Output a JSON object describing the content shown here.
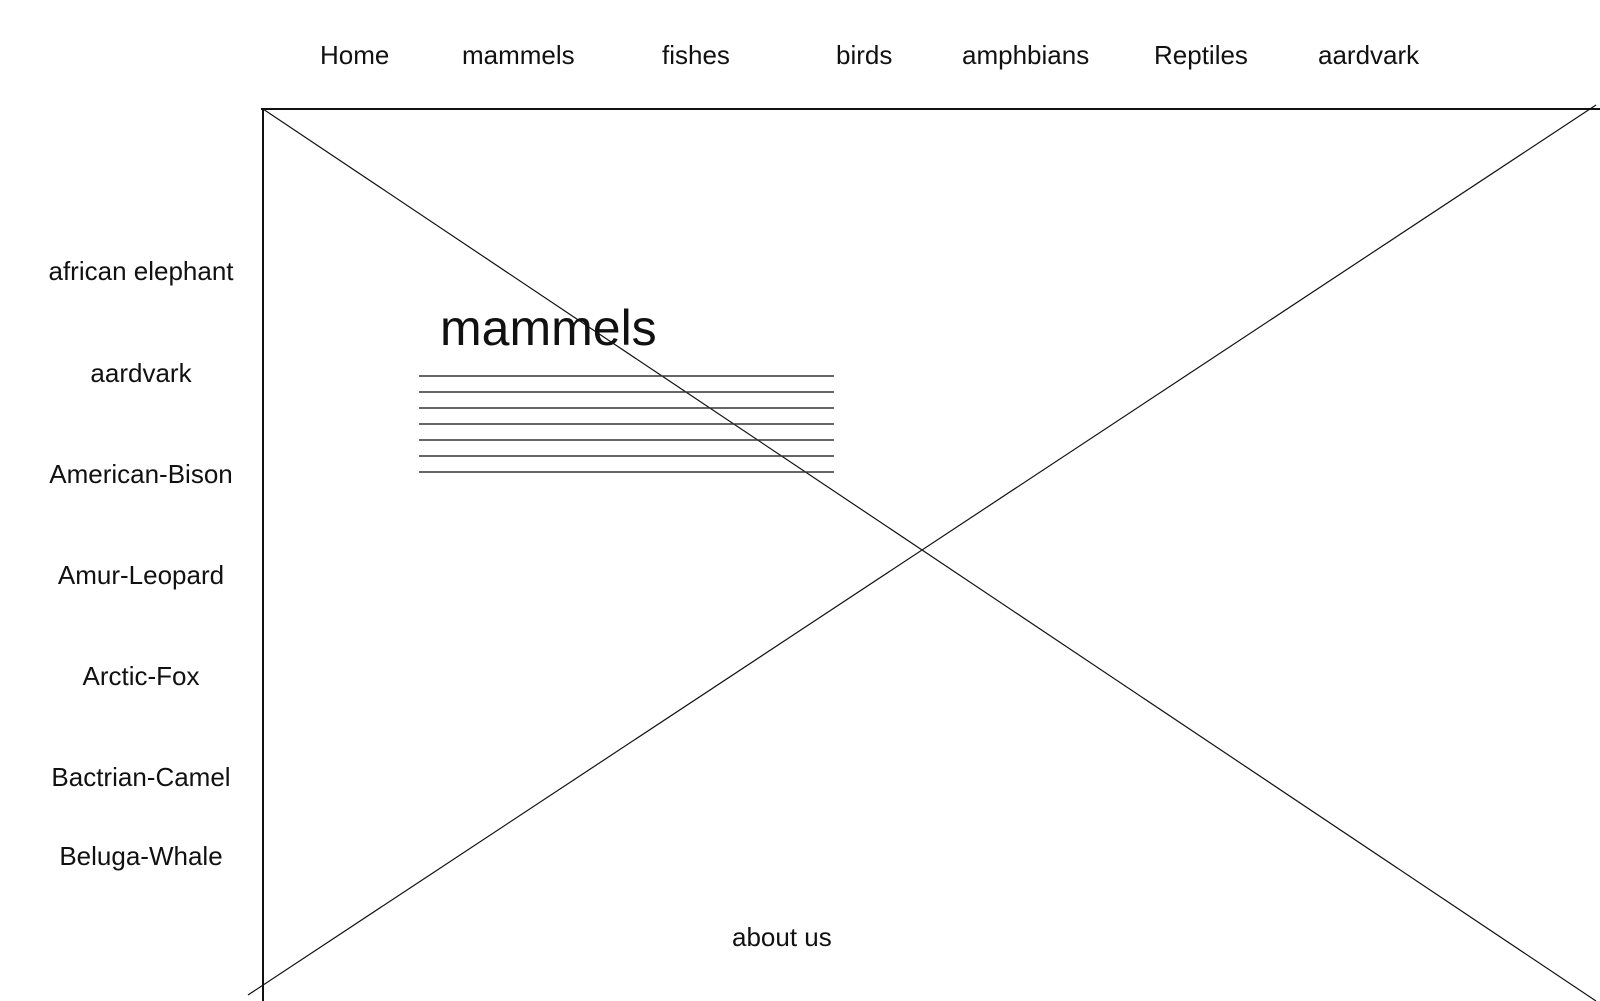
{
  "nav": {
    "items": [
      "Home",
      "mammels",
      "fishes",
      "birds",
      "amphbians",
      "Reptiles",
      "aardvark"
    ]
  },
  "sidebar": {
    "items": [
      "african elephant",
      "aardvark",
      "American-Bison",
      "Amur-Leopard",
      "Arctic-Fox",
      "Bactrian-Camel",
      "Beluga-Whale"
    ]
  },
  "main": {
    "image_placeholder": "image-placeholder-icon",
    "heading": "mammels"
  },
  "footer": {
    "about_label": "about us"
  }
}
